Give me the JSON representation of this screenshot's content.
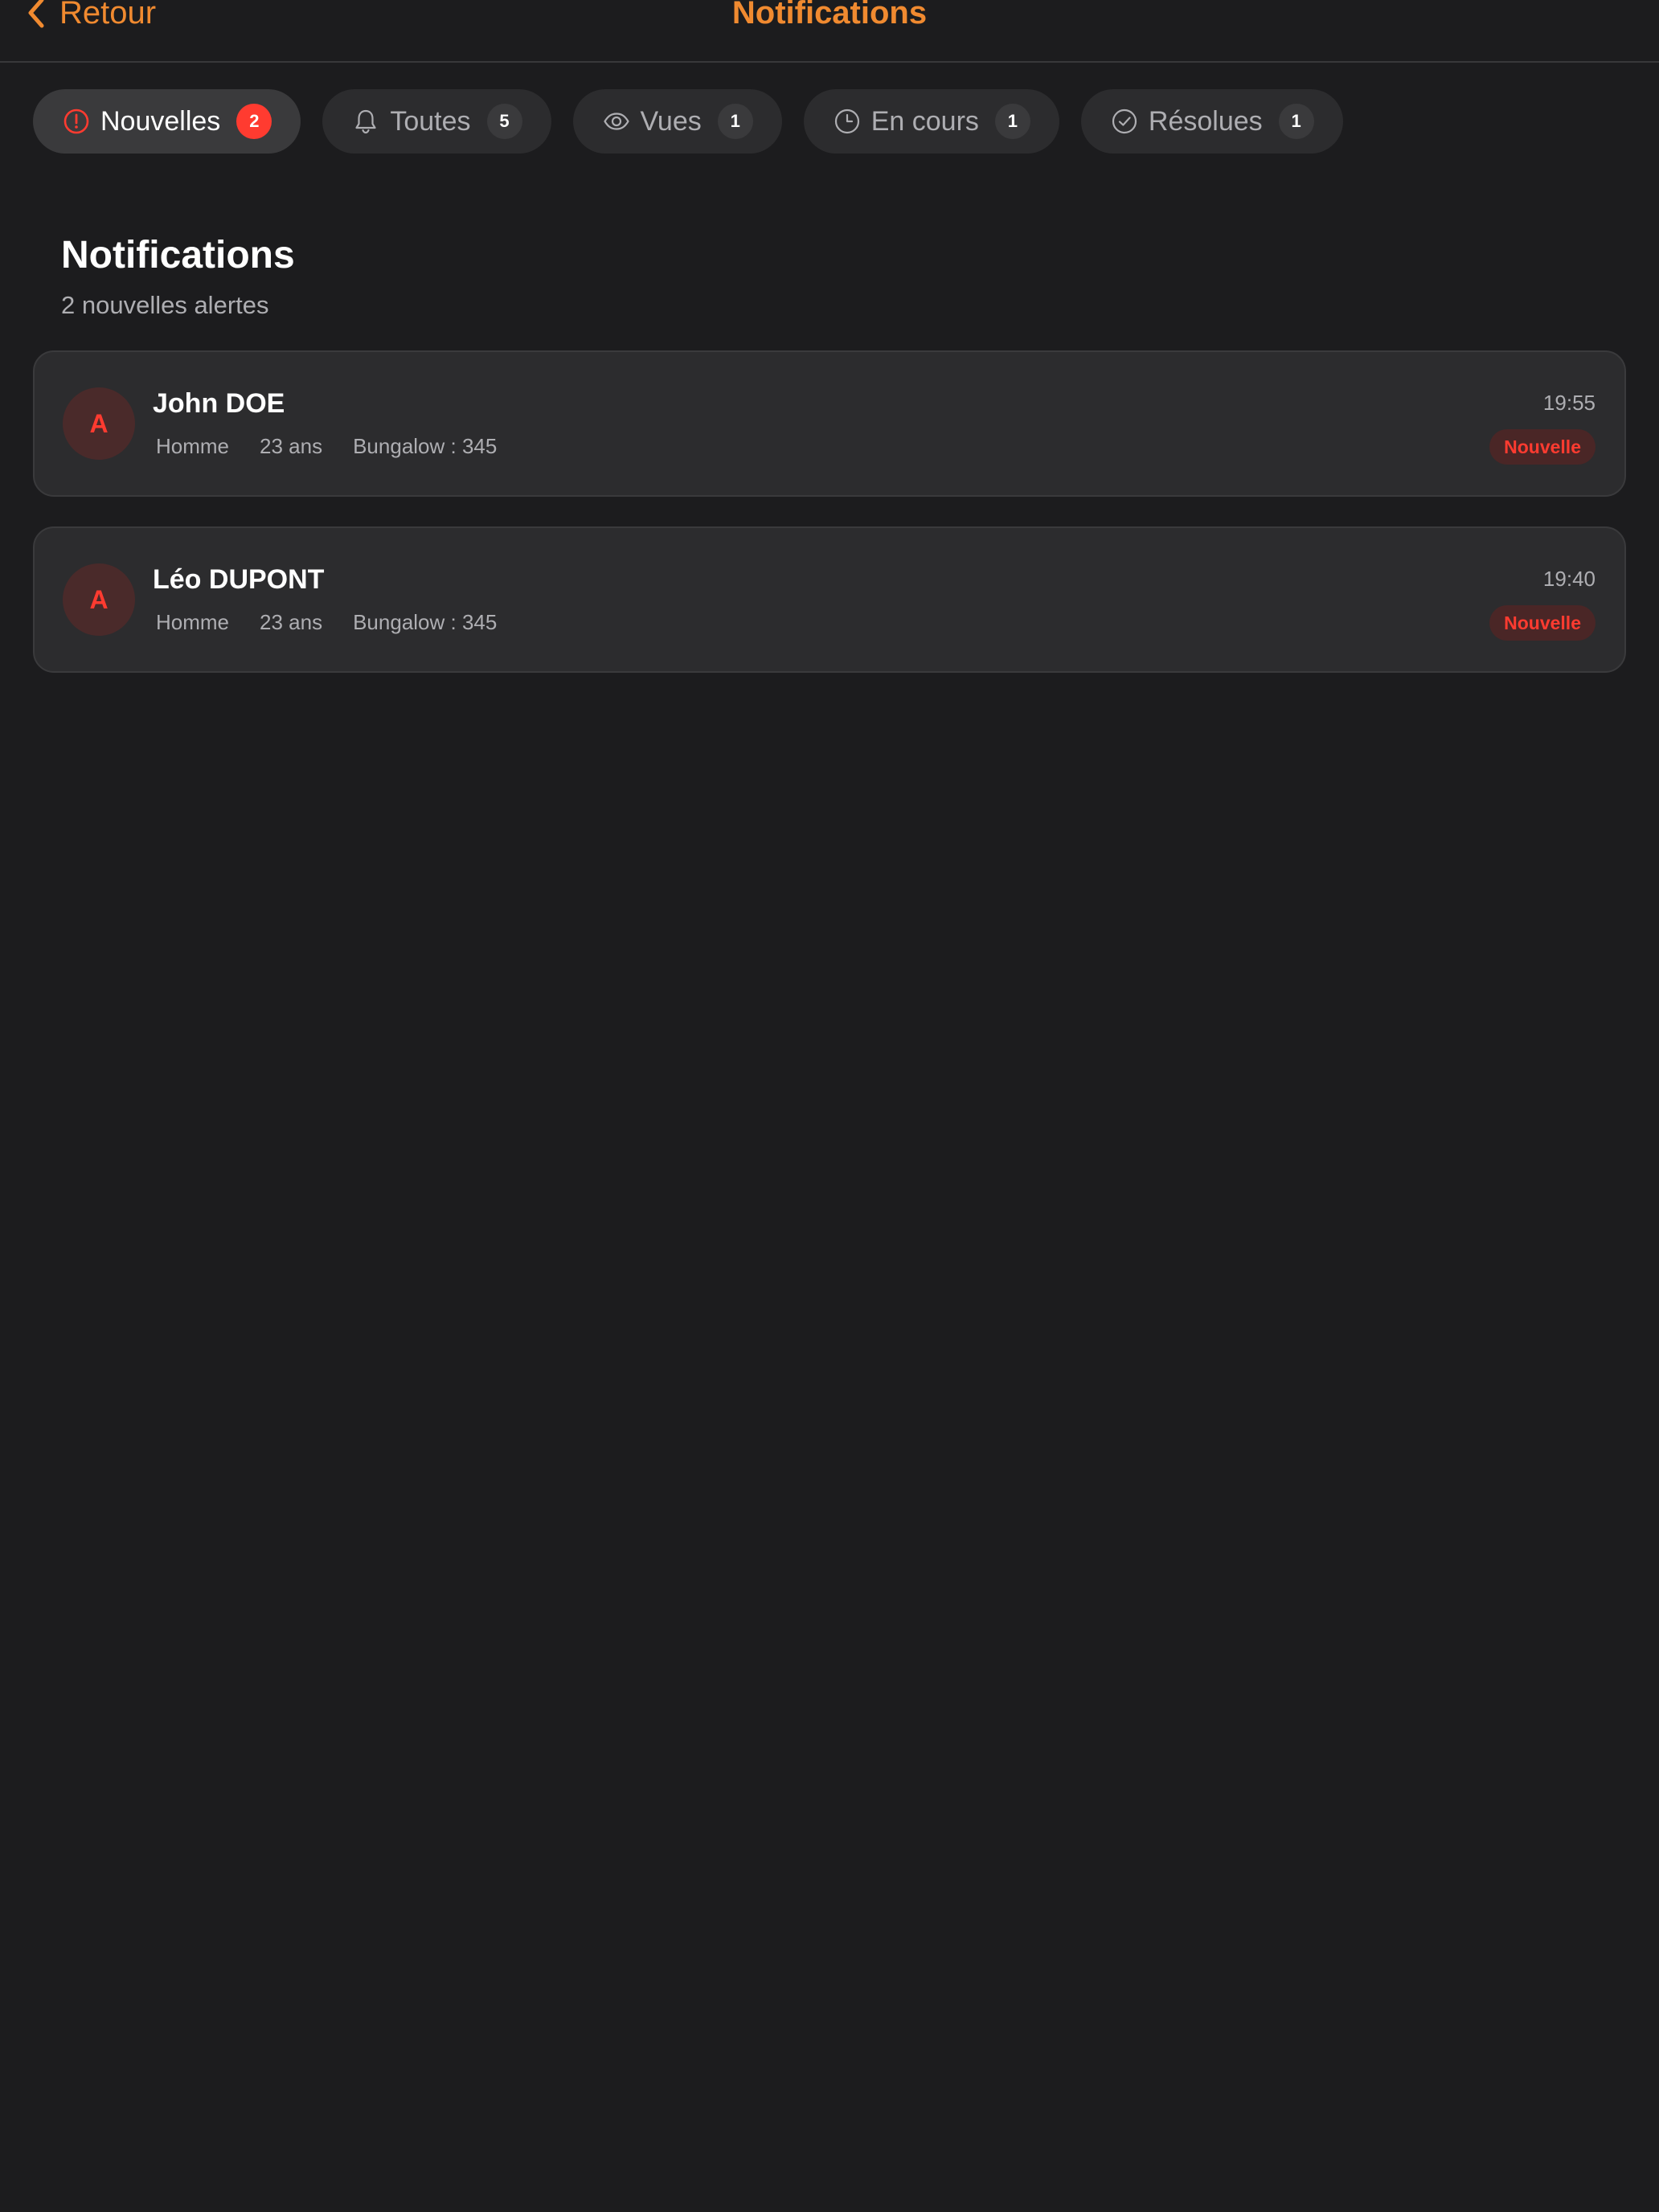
{
  "colors": {
    "accent": "#f08a30",
    "alert_red": "#ff3b30",
    "background": "#1c1c1e",
    "card": "#2c2c2e"
  },
  "nav": {
    "back_label": "Retour",
    "back_icon": "chevron-left-icon",
    "title": "Notifications"
  },
  "tabs": [
    {
      "label": "Nouvelles",
      "count": "2",
      "icon": "alert-circle-icon",
      "selected": true
    },
    {
      "label": "Toutes",
      "count": "5",
      "icon": "bell-icon",
      "selected": false
    },
    {
      "label": "Vues",
      "count": "1",
      "icon": "eye-icon",
      "selected": false
    },
    {
      "label": "En cours",
      "count": "1",
      "icon": "clock-icon",
      "selected": false
    },
    {
      "label": "Résolues",
      "count": "1",
      "icon": "check-circle-icon",
      "selected": false
    }
  ],
  "section": {
    "title": "Notifications",
    "subtitle": "2 nouvelles alertes"
  },
  "alerts": [
    {
      "avatar": "A",
      "name": "John DOE",
      "gender": "Homme",
      "age": "23 ans",
      "bungalow": "Bungalow : 345",
      "time": "19:55",
      "status": "Nouvelle"
    },
    {
      "avatar": "A",
      "name": "Léo DUPONT",
      "gender": "Homme",
      "age": "23 ans",
      "bungalow": "Bungalow : 345",
      "time": "19:40",
      "status": "Nouvelle"
    }
  ]
}
